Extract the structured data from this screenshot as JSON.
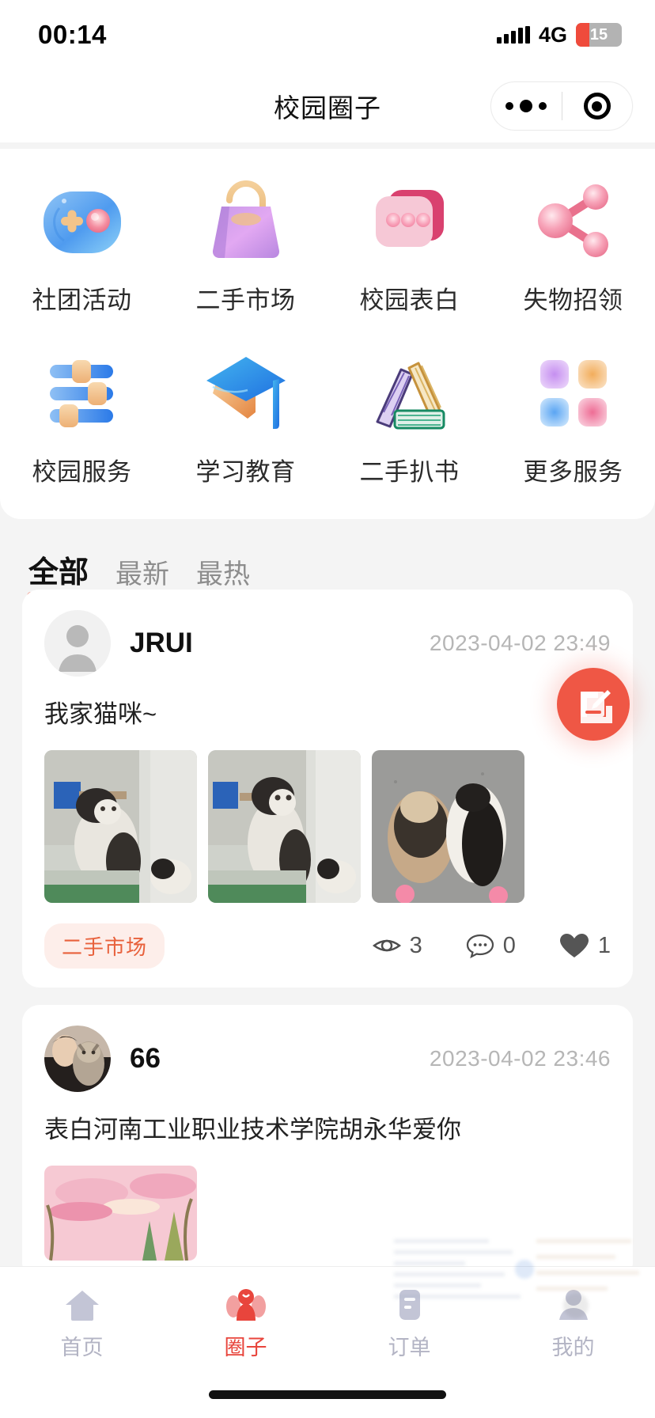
{
  "status_bar": {
    "time": "00:14",
    "network": "4G",
    "battery_level": "15",
    "signal_icon": "signal-bars-icon"
  },
  "nav": {
    "title": "校园圈子",
    "capsule": {
      "more_icon": "more-dots-icon",
      "target_icon": "target-circle-icon"
    }
  },
  "grid": {
    "rows": [
      [
        {
          "label": "社团活动",
          "icon": "gamepad-icon"
        },
        {
          "label": "二手市场",
          "icon": "handbag-icon"
        },
        {
          "label": "校园表白",
          "icon": "chat-bubble-icon"
        },
        {
          "label": "失物招领",
          "icon": "share-nodes-icon"
        }
      ],
      [
        {
          "label": "校园服务",
          "icon": "sliders-icon"
        },
        {
          "label": "学习教育",
          "icon": "graduation-cap-icon"
        },
        {
          "label": "二手扒书",
          "icon": "books-icon"
        },
        {
          "label": "更多服务",
          "icon": "grid-squares-icon"
        }
      ]
    ]
  },
  "filter_tabs": [
    {
      "label": "全部",
      "active": true
    },
    {
      "label": "最新",
      "active": false
    },
    {
      "label": "最热",
      "active": false
    }
  ],
  "posts": [
    {
      "user": "JRUI",
      "time": "2023-04-02 23:49",
      "text": "我家猫咪~",
      "avatar_type": "placeholder-avatar",
      "tag": "二手市场",
      "views": "3",
      "comments": "0",
      "likes": "1",
      "image_count": 3
    },
    {
      "user": "66",
      "time": "2023-04-02 23:46",
      "text": "表白河南工业职业技术学院胡永华爱你",
      "avatar_type": "photo-avatar",
      "image_count": 1
    }
  ],
  "fab": {
    "icon": "compose-edit-icon"
  },
  "tabbar": [
    {
      "label": "首页",
      "icon": "home-icon",
      "active": false
    },
    {
      "label": "圈子",
      "icon": "community-icon",
      "active": true
    },
    {
      "label": "订单",
      "icon": "order-list-icon",
      "active": false
    },
    {
      "label": "我的",
      "icon": "person-icon",
      "active": false
    }
  ],
  "colors": {
    "accent": "#ef5745",
    "tab_active": "#e8453c",
    "tag_text": "#e8613c",
    "tag_bg": "#fdeeea",
    "inactive": "#b3b4c4"
  }
}
